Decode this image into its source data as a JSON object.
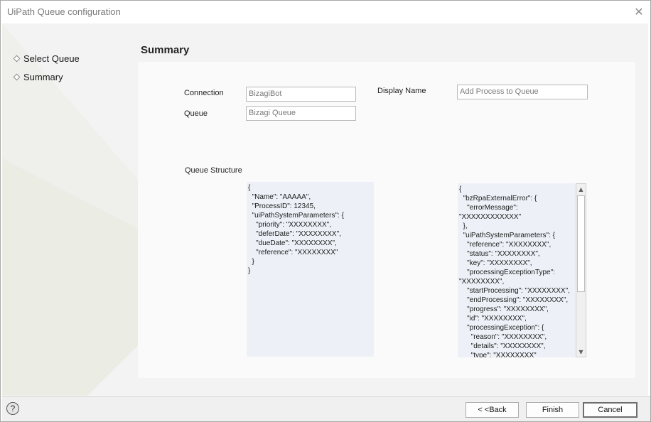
{
  "window": {
    "title": "UiPath Queue configuration"
  },
  "nav": {
    "items": [
      {
        "label": "Select Queue"
      },
      {
        "label": "Summary"
      }
    ]
  },
  "summary": {
    "title": "Summary",
    "connection": {
      "label": "Connection",
      "value": "BizagiBot"
    },
    "queue": {
      "label": "Queue",
      "value": "Bizagi Queue"
    },
    "display_name": {
      "label": "Display Name",
      "value": "Add Process to Queue"
    },
    "queue_structure": {
      "label": "Queue Structure",
      "input_json": "{\n  \"Name\": \"AAAAA\",\n  \"ProcessID\": 12345,\n  \"uiPathSystemParameters\": {\n    \"priority\": \"XXXXXXXX\",\n    \"deferDate\": \"XXXXXXXX\",\n    \"dueDate\": \"XXXXXXXX\",\n    \"reference\": \"XXXXXXXX\"\n  }\n}",
      "output_json": "{\n  \"bzRpaExternalError\": {\n    \"errorMessage\":\n\"XXXXXXXXXXXX\"\n  },\n  \"uiPathSystemParameters\": {\n    \"reference\": \"XXXXXXXX\",\n    \"status\": \"XXXXXXXX\",\n    \"key\": \"XXXXXXXX\",\n    \"processingExceptionType\":\n\"XXXXXXXX\",\n    \"startProcessing\": \"XXXXXXXX\",\n    \"endProcessing\": \"XXXXXXXX\",\n    \"progress\": \"XXXXXXXX\",\n    \"id\": \"XXXXXXXX\",\n    \"processingException\": {\n      \"reason\": \"XXXXXXXX\",\n      \"details\": \"XXXXXXXX\",\n      \"type\": \"XXXXXXXX\""
    }
  },
  "footer": {
    "help_symbol": "?",
    "back_label": "< <Back",
    "finish_label": "Finish",
    "cancel_label": "Cancel"
  },
  "icons": {
    "close": "close-icon",
    "help": "help-icon",
    "scroll_up": "scroll-up-icon",
    "scroll_down": "scroll-down-icon"
  },
  "colors": {
    "panel_background": "#fafafa",
    "json_background": "#edf1f7",
    "window_background": "#f3f3f3",
    "footer_background": "#f0f0f0"
  }
}
